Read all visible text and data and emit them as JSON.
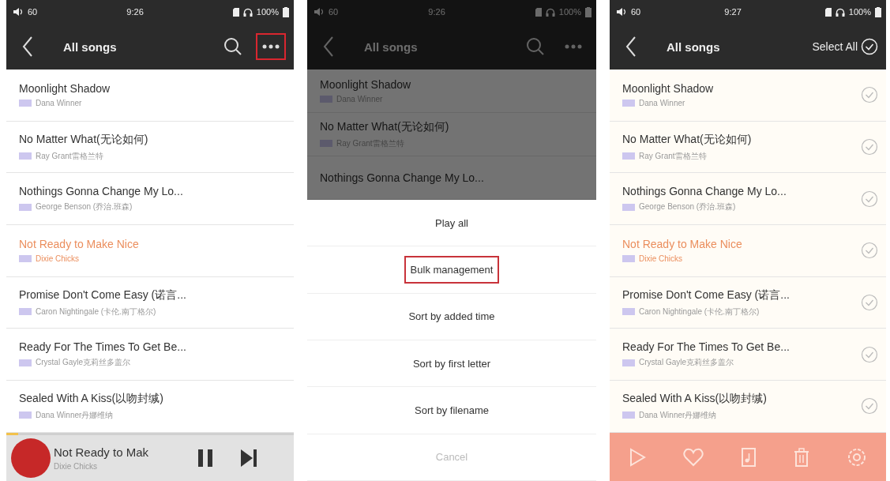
{
  "screens": [
    {
      "kind": "list",
      "status": {
        "volume": "60",
        "time": "9:26",
        "battery": "100%"
      },
      "header": {
        "title": "All songs",
        "actions": [
          {
            "kind": "search",
            "highlighted": false
          },
          {
            "kind": "more",
            "highlighted": true
          }
        ]
      },
      "songs": [
        {
          "title": "Moonlight Shadow",
          "artist": "Dana Winner",
          "playing": false
        },
        {
          "title": "No Matter What(无论如何)",
          "artist": "Ray Grant雷格兰特",
          "playing": false
        },
        {
          "title": "Nothings Gonna Change My Lo...",
          "artist": "George Benson (乔治.班森)",
          "playing": false
        },
        {
          "title": "Not Ready to Make Nice",
          "artist": "Dixie Chicks",
          "playing": true
        },
        {
          "title": "Promise Don't Come Easy (诺言...",
          "artist": "Caron Nightingale (卡伦.南丁格尔)",
          "playing": false
        },
        {
          "title": "Ready For The Times To Get Be...",
          "artist": "Crystal Gayle克莉丝多盖尔",
          "playing": false
        },
        {
          "title": "Sealed With A Kiss(以吻封缄)",
          "artist": "Dana Winner丹娜维纳",
          "playing": false
        }
      ],
      "player": {
        "title": "Not Ready to Mak",
        "artist": "Dixie Chicks",
        "level": 0.04
      }
    },
    {
      "kind": "menu",
      "status": {
        "volume": "60",
        "time": "9:26",
        "battery": "100%"
      },
      "header": {
        "title": "All songs",
        "actions": [
          {
            "kind": "search",
            "highlighted": false
          },
          {
            "kind": "more",
            "highlighted": false
          }
        ]
      },
      "songs": [
        {
          "title": "Moonlight Shadow",
          "artist": "Dana Winner",
          "playing": false
        },
        {
          "title": "No Matter What(无论如何)",
          "artist": "Ray Grant雷格兰特",
          "playing": false
        },
        {
          "title": "Nothings Gonna Change My Lo...",
          "playing": false
        }
      ],
      "menu": [
        {
          "label": "Play all",
          "kind": "option",
          "highlighted": false
        },
        {
          "label": "Bulk management",
          "kind": "option",
          "highlighted": true
        },
        {
          "label": "Sort by added time",
          "kind": "option",
          "highlighted": false
        },
        {
          "label": "Sort by first letter",
          "kind": "option",
          "highlighted": false
        },
        {
          "label": "Sort by filename",
          "kind": "option",
          "highlighted": false
        },
        {
          "label": "Cancel",
          "kind": "cancel",
          "highlighted": false
        }
      ]
    },
    {
      "kind": "select",
      "status": {
        "volume": "60",
        "time": "9:27",
        "battery": "100%"
      },
      "header": {
        "title": "All songs",
        "select_all": {
          "label": "Select All",
          "checked": false
        }
      },
      "songs": [
        {
          "title": "Moonlight Shadow",
          "artist": "Dana Winner",
          "playing": false,
          "checked": false
        },
        {
          "title": "No Matter What(无论如何)",
          "artist": "Ray Grant雷格兰特",
          "playing": false,
          "checked": false
        },
        {
          "title": "Nothings Gonna Change My Lo...",
          "artist": "George Benson (乔治.班森)",
          "playing": false,
          "checked": false
        },
        {
          "title": "Not Ready to Make Nice",
          "artist": "Dixie Chicks",
          "playing": true,
          "checked": false
        },
        {
          "title": "Promise Don't Come Easy (诺言...",
          "artist": "Caron Nightingale (卡伦.南丁格尔)",
          "playing": false,
          "checked": false
        },
        {
          "title": "Ready For The Times To Get Be...",
          "artist": "Crystal Gayle克莉丝多盖尔",
          "playing": false,
          "checked": false
        },
        {
          "title": "Sealed With A Kiss(以吻封缄)",
          "artist": "Dana Winner丹娜维纳",
          "playing": false,
          "checked": false
        }
      ],
      "toolbar": [
        {
          "kind": "play"
        },
        {
          "kind": "favorite"
        },
        {
          "kind": "playlist"
        },
        {
          "kind": "delete"
        },
        {
          "kind": "settings"
        }
      ]
    }
  ]
}
